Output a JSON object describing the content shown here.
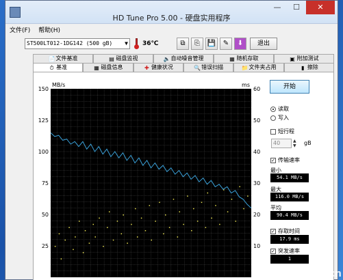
{
  "window": {
    "title": "HD Tune Pro 5.00 - 硬盘实用程序"
  },
  "menu": [
    "文件(F)",
    "帮助(H)"
  ],
  "toolbar": {
    "drive": "ST500LT012-1DG142 (500 gB)",
    "temperature": "36℃",
    "exit_label": "退出"
  },
  "tabs": {
    "row1": [
      "文件基准",
      "磁盘监视",
      "自动噪音管理",
      "随机存取",
      "附加测试"
    ],
    "row2": [
      "基准",
      "磁盘信息",
      "健康状况",
      "错误扫描",
      "文件夹占用",
      "擦除"
    ],
    "active": "基准"
  },
  "controls": {
    "start_label": "开始",
    "read_label": "读取",
    "write_label": "写入",
    "short_stroke_label": "短行程",
    "short_stroke_value": "40",
    "short_stroke_unit": "gB",
    "transfer_rate_label": "传输速率",
    "min_label": "最小",
    "min_value": "54.1 MB/s",
    "max_label": "最大",
    "max_value": "116.0 MB/s",
    "avg_label": "平均",
    "avg_value": "90.4 MB/s",
    "access_time_label": "存取时间",
    "access_time_value": "17.9 ms",
    "burst_label": "突发速率",
    "burst_value": "1"
  },
  "chart_data": {
    "type": "line",
    "left_axis": {
      "label": "MB/s",
      "ticks": [
        150,
        125,
        100,
        75,
        50,
        25
      ],
      "ylim": [
        0,
        150
      ]
    },
    "right_axis": {
      "label": "ms",
      "ticks": [
        60,
        50,
        40,
        30,
        20,
        10
      ],
      "ylim": [
        0,
        60
      ]
    },
    "grid": true,
    "series": [
      {
        "color": "#3aa0d8",
        "x": [
          0,
          2,
          4,
          6,
          8,
          10,
          12,
          14,
          16,
          18,
          20,
          22,
          24,
          26,
          28,
          30,
          32,
          34,
          36,
          38,
          40,
          42,
          44,
          46,
          48,
          50,
          52,
          54,
          56,
          58,
          60,
          62,
          64,
          66,
          68,
          70,
          72,
          74,
          76,
          78,
          80,
          82,
          84,
          86,
          88,
          90,
          92,
          94,
          96,
          98,
          100
        ],
        "y": [
          115,
          112,
          113,
          109,
          110,
          106,
          108,
          104,
          108,
          102,
          106,
          100,
          104,
          98,
          102,
          96,
          100,
          95,
          99,
          93,
          97,
          91,
          95,
          89,
          93,
          87,
          91,
          86,
          89,
          84,
          87,
          82,
          85,
          80,
          83,
          78,
          81,
          76,
          79,
          74,
          77,
          72,
          74,
          70,
          72,
          67,
          69,
          64,
          62,
          58,
          55
        ]
      },
      {
        "color": "#e8e050",
        "style": "scatter",
        "note_axis": "ms",
        "x": [
          2,
          4,
          5,
          7,
          9,
          11,
          12,
          14,
          16,
          17,
          19,
          21,
          22,
          24,
          26,
          28,
          29,
          31,
          33,
          35,
          36,
          38,
          40,
          42,
          43,
          45,
          47,
          49,
          50,
          52,
          54,
          56,
          57,
          59,
          61,
          63,
          64,
          66,
          68,
          70,
          71,
          73,
          75,
          77,
          78,
          80,
          82,
          84,
          86,
          88,
          90,
          92,
          94,
          96,
          98
        ],
        "y": [
          10,
          14,
          6,
          12,
          16,
          9,
          13,
          18,
          8,
          15,
          11,
          17,
          13,
          19,
          10,
          16,
          21,
          12,
          18,
          14,
          20,
          11,
          17,
          22,
          13,
          19,
          15,
          23,
          12,
          18,
          24,
          14,
          20,
          16,
          25,
          13,
          21,
          17,
          26,
          15,
          22,
          18,
          24,
          16,
          27,
          19,
          23,
          17,
          28,
          21,
          25,
          18,
          29,
          22,
          26
        ]
      }
    ]
  },
  "watermark": "zol.com.cn"
}
